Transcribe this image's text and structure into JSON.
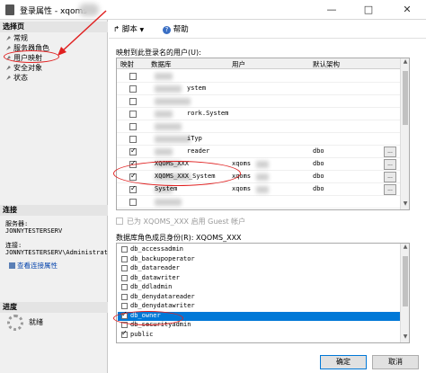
{
  "window": {
    "title": "登录属性 - xqoms",
    "min": "—",
    "max": "□",
    "close": "✕"
  },
  "left": {
    "select_page_header": "选择页",
    "pages": [
      "常规",
      "服务器角色",
      "用户映射",
      "安全对象",
      "状态"
    ],
    "connection_header": "连接",
    "server_label": "服务器:",
    "server_value": "JONNYTESTERSERV",
    "conn_label": "连接:",
    "conn_value": "JONNYTESTERSERV\\Administrat",
    "view_link": "查看连接属性",
    "progress_header": "进度",
    "status": "就绪"
  },
  "toolbar": {
    "script": "脚本",
    "help": "帮助"
  },
  "mapping": {
    "label": "映射到此登录名的用户(U):",
    "columns": [
      "映射",
      "数据库",
      "用户",
      "默认架构"
    ],
    "rows": [
      {
        "checked": false,
        "db": "",
        "user": "",
        "schema": ""
      },
      {
        "checked": false,
        "db": "ystem",
        "user": "",
        "schema": ""
      },
      {
        "checked": false,
        "db": "",
        "user": "",
        "schema": ""
      },
      {
        "checked": false,
        "db": "rork.System",
        "user": "",
        "schema": ""
      },
      {
        "checked": false,
        "db": "",
        "user": "",
        "schema": ""
      },
      {
        "checked": false,
        "db": "iTyp",
        "user": "",
        "schema": ""
      },
      {
        "checked": true,
        "db": "reader",
        "user": "",
        "schema": "dbo"
      },
      {
        "checked": true,
        "db": "XQOMS_XXX",
        "user": "xqoms",
        "schema": "dbo"
      },
      {
        "checked": true,
        "db": "XQOMS_XXX_System",
        "user": "xqoms",
        "schema": "dbo"
      },
      {
        "checked": true,
        "db": "System",
        "user": "xqoms",
        "schema": "dbo"
      },
      {
        "checked": false,
        "db": "",
        "user": "",
        "schema": ""
      }
    ],
    "ellipsis": "..."
  },
  "guest": {
    "text": "已为 XQOMS_XXX 启用 Guest 帐户"
  },
  "roles": {
    "label": "数据库角色成员身份(R): XQOMS_XXX",
    "items": [
      {
        "name": "db_accessadmin",
        "checked": false,
        "selected": false
      },
      {
        "name": "db_backupoperator",
        "checked": false,
        "selected": false
      },
      {
        "name": "db_datareader",
        "checked": false,
        "selected": false
      },
      {
        "name": "db_datawriter",
        "checked": false,
        "selected": false
      },
      {
        "name": "db_ddladmin",
        "checked": false,
        "selected": false
      },
      {
        "name": "db_denydatareader",
        "checked": false,
        "selected": false
      },
      {
        "name": "db_denydatawriter",
        "checked": false,
        "selected": false
      },
      {
        "name": "db_owner",
        "checked": true,
        "selected": true
      },
      {
        "name": "db_securityadmin",
        "checked": false,
        "selected": false
      },
      {
        "name": "public",
        "checked": true,
        "selected": false
      }
    ]
  },
  "buttons": {
    "ok": "确定",
    "cancel": "取消"
  },
  "colors": {
    "selection": "#0078d7",
    "annotation": "#e02020",
    "link": "#0645ad"
  }
}
